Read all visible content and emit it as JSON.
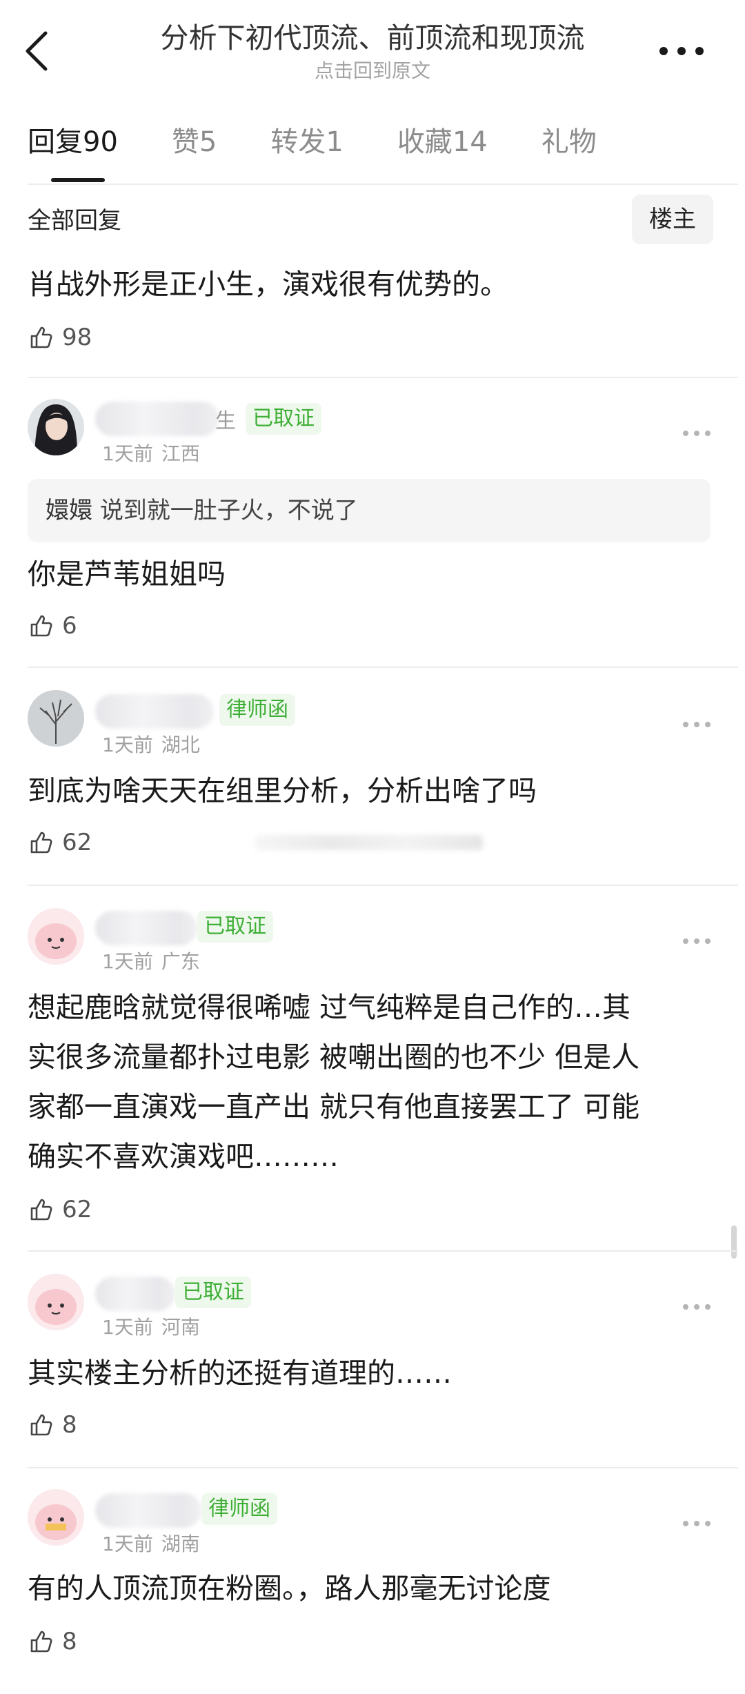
{
  "header": {
    "title": "分析下初代顶流、前顶流和现顶流",
    "subtitle": "点击回到原文"
  },
  "tabs": [
    {
      "label": "回复",
      "count": "90"
    },
    {
      "label": "赞",
      "count": "5"
    },
    {
      "label": "转发",
      "count": "1"
    },
    {
      "label": "收藏",
      "count": "14"
    },
    {
      "label": "礼物",
      "count": ""
    }
  ],
  "filter": {
    "label": "全部回复",
    "op_button": "楼主"
  },
  "top_comment": {
    "text": "肖战外形是正小生，演戏很有优势的。",
    "likes": "98"
  },
  "comments": [
    {
      "name_fragment": "生",
      "badge": "已取证",
      "time": "1天前",
      "location": "江西",
      "quote_name": "嬛嬛",
      "quote_text": "说到就一肚子火，不说了",
      "text": "你是芦苇姐姐吗",
      "likes": "6"
    },
    {
      "name_fragment": "",
      "badge": "律师函",
      "time": "1天前",
      "location": "湖北",
      "text": "到底为啥天天在组里分析，分析出啥了吗",
      "likes": "62"
    },
    {
      "name_fragment": "",
      "badge": "已取证",
      "time": "1天前",
      "location": "广东",
      "text_lines": [
        "想起鹿晗就觉得很唏嘘 过气纯粹是自己作的…其",
        "实很多流量都扑过电影 被嘲出圈的也不少 但是人",
        "家都一直演戏一直产出 就只有他直接罢工了 可能",
        "确实不喜欢演戏吧………"
      ],
      "likes": "62"
    },
    {
      "name_fragment": "",
      "badge": "已取证",
      "time": "1天前",
      "location": "河南",
      "text": "其实楼主分析的还挺有道理的……",
      "likes": "8"
    },
    {
      "name_fragment": "",
      "badge": "律师函",
      "time": "1天前",
      "location": "湖南",
      "text": "有的人顶流顶在粉圈。，路人那毫无讨论度",
      "likes": "8"
    }
  ],
  "colors": {
    "badge_green": "#3eaf36",
    "badge_bg": "#eef8ec",
    "text_primary": "#1a1a1a",
    "text_meta": "#a0a0a0"
  }
}
